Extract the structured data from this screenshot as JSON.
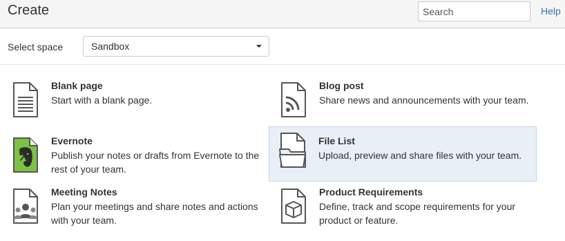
{
  "header": {
    "title": "Create",
    "search_placeholder": "Search",
    "help_label": "Help"
  },
  "space": {
    "label": "Select space",
    "selected": "Sandbox"
  },
  "blueprints": [
    {
      "title": "Blank page",
      "description": "Start with a blank page.",
      "icon": "blank-page-icon"
    },
    {
      "title": "Blog post",
      "description": "Share news and announcements with your team.",
      "icon": "blog-post-icon"
    },
    {
      "title": "Evernote",
      "description": "Publish your notes or drafts from Evernote to the rest of your team.",
      "icon": "evernote-icon"
    },
    {
      "title": "File List",
      "description": "Upload, preview and share files with your team.",
      "icon": "file-list-icon",
      "selected": true
    },
    {
      "title": "Meeting Notes",
      "description": "Plan your meetings and share notes and actions with your team.",
      "icon": "meeting-notes-icon"
    },
    {
      "title": "Product Requirements",
      "description": "Define, track and scope requirements for your product or feature.",
      "icon": "product-requirements-icon"
    }
  ],
  "colors": {
    "link": "#3572b0",
    "selected_background": "#e9eff6",
    "icon_stroke": "#555555",
    "evernote_green": "#7cc243"
  }
}
